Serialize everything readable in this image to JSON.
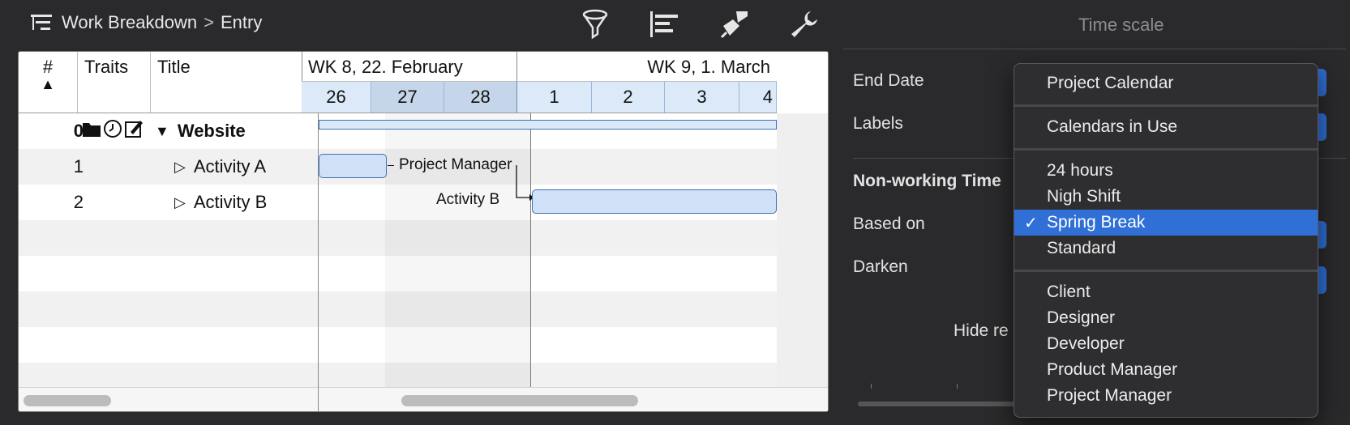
{
  "toolbar": {
    "breadcrumb": [
      "Work Breakdown",
      "Entry"
    ],
    "breadcrumb_separator": ">",
    "icons": [
      "filter-icon",
      "gantt-layout-icon",
      "style-brush-icon",
      "settings-wrench-icon"
    ]
  },
  "gantt": {
    "columns": [
      "#",
      "Traits",
      "Title"
    ],
    "weeks": [
      "WK 8, 22. February",
      "WK 9, 1. March"
    ],
    "days": [
      "26",
      "27",
      "28",
      "1",
      "2",
      "3",
      "4"
    ],
    "rows": [
      {
        "num": "0",
        "title": "Website",
        "type": "summary"
      },
      {
        "num": "1",
        "title": "Activity A",
        "type": "task",
        "resource_label": "Project Manager"
      },
      {
        "num": "2",
        "title": "Activity B",
        "type": "task",
        "resource_label": "Activity B"
      }
    ],
    "colors": {
      "bar_fill": "#cfe0f7",
      "bar_border": "#3f6fb6"
    }
  },
  "inspector": {
    "title": "Time scale",
    "labels": {
      "end_date": "End Date",
      "labels": "Labels",
      "nonworking": "Non-working Time",
      "based_on": "Based on",
      "darken": "Darken",
      "hide": "Hide re"
    }
  },
  "menu": {
    "group1": [
      "Project Calendar"
    ],
    "group2": [
      "Calendars in Use"
    ],
    "group3": [
      "24 hours",
      "Nigh Shift",
      "Spring Break",
      "Standard"
    ],
    "group4": [
      "Client",
      "Designer",
      "Developer",
      "Product Manager",
      "Project Manager"
    ],
    "selected": "Spring Break",
    "check": "✓",
    "accent": "#2f6fd6"
  }
}
